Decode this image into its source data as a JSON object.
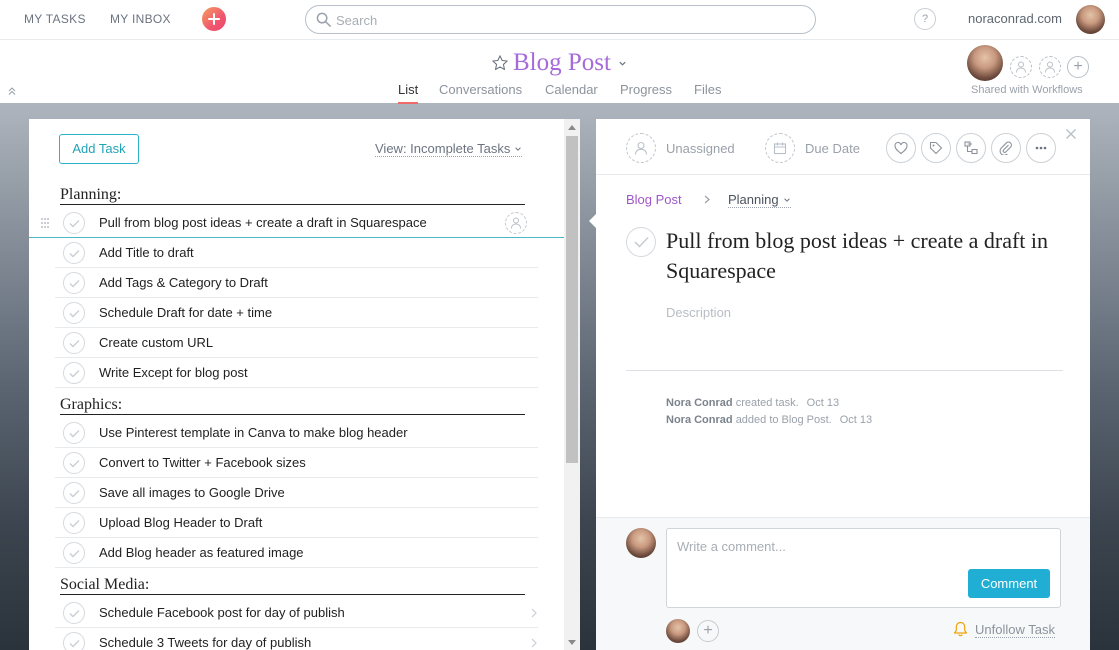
{
  "topbar": {
    "my_tasks": "MY TASKS",
    "my_inbox": "MY INBOX",
    "search_placeholder": "Search",
    "help": "?",
    "org": "noraconrad.com"
  },
  "header": {
    "project_title": "Blog Post",
    "tabs": [
      "List",
      "Conversations",
      "Calendar",
      "Progress",
      "Files"
    ],
    "active_tab": "List",
    "shared": "Shared with Workflows"
  },
  "list": {
    "add_task": "Add Task",
    "view": "View: Incomplete Tasks",
    "sections": [
      {
        "name": "Planning:",
        "tasks": [
          "Pull from blog post ideas + create a draft in Squarespace",
          "Add Title to draft",
          "Add Tags & Category to Draft",
          "Schedule Draft for date + time",
          "Create custom URL",
          "Write Except for blog post"
        ]
      },
      {
        "name": "Graphics:",
        "tasks": [
          "Use Pinterest template in Canva to make blog header",
          "Convert to Twitter + Facebook sizes",
          "Save all images to Google Drive",
          "Upload Blog Header to Draft",
          "Add Blog header as featured image"
        ]
      },
      {
        "name": "Social Media:",
        "tasks": [
          "Schedule Facebook post for day of publish",
          "Schedule 3 Tweets for day of publish"
        ]
      }
    ]
  },
  "detail": {
    "assignee": "Unassigned",
    "due_date": "Due Date",
    "breadcrumb_project": "Blog Post",
    "breadcrumb_section": "Planning",
    "title": "Pull from blog post ideas + create a draft in Squarespace",
    "description_placeholder": "Description",
    "stories": [
      {
        "actor": "Nora Conrad",
        "action": "created task.",
        "date": "Oct 13"
      },
      {
        "actor": "Nora Conrad",
        "action": "added to Blog Post.",
        "date": "Oct 13"
      }
    ],
    "comment_placeholder": "Write a comment...",
    "comment_button": "Comment",
    "unfollow": "Unfollow Task"
  },
  "colors": {
    "accent_purple": "#a56bd8",
    "accent_teal": "#21aed4",
    "tab_underline": "#f06a6a",
    "add_button": "#f1566f"
  }
}
